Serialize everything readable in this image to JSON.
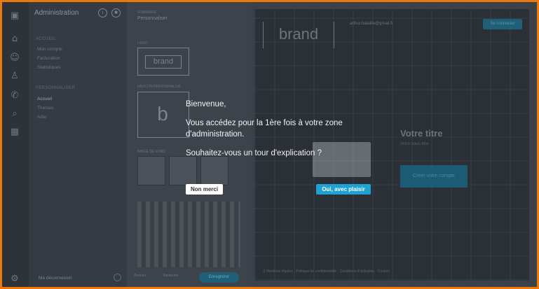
{
  "sidebar": {
    "title": "Administration",
    "sections": [
      "Accueil",
      "Personnaliser"
    ],
    "items_top": [
      "Mon compte",
      "Facturation",
      "Statistiques"
    ],
    "items_mid": [
      "Accueil",
      "Themes",
      "Aide"
    ],
    "footer": "Ma déconnexion"
  },
  "mid": {
    "small_label": "Sommaire",
    "title": "Personnaliser",
    "brand_text": "brand",
    "sec_logo": "Logo",
    "sec_favicon": "Favicon personnalisé",
    "sec_images": "Image de fond",
    "foot_left": "Annuler",
    "foot_mid": "Restaurer",
    "save": "Enregistrer"
  },
  "preview": {
    "brand": "brand",
    "email": "arthur.bataille@gmail.fr",
    "top_button": "Se connecter",
    "title": "Votre titre",
    "subtitle": "Votre sous-titre",
    "cta": "Créer votre compte",
    "footer": "© Mentions légales · Politique de confidentialité · Conditions d'utilisation · Contact"
  },
  "modal": {
    "greeting": "Bienvenue,",
    "line1": "Vous accédez pour la 1ère fois à votre zone",
    "line2": "d'administration.",
    "question": "Souhaitez-vous un tour d'explication ?",
    "decline": "Non merci",
    "accept": "Oui, avec plaisir"
  },
  "colors": {
    "border": "#ec7a0a",
    "accent": "#1ea2d4"
  },
  "icons": [
    "logo-icon",
    "home-icon",
    "users-icon",
    "user-icon",
    "phone-icon",
    "search-icon",
    "layout-icon",
    "settings-icon",
    "info-icon",
    "gear-icon"
  ]
}
